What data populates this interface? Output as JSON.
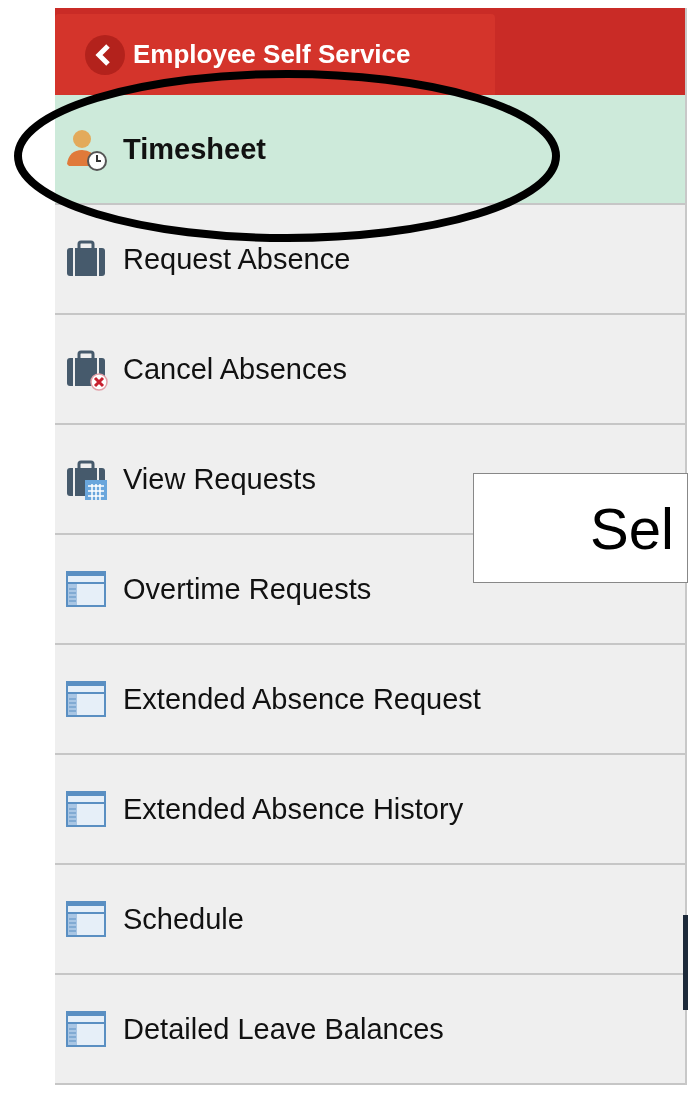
{
  "header": {
    "back_label": "Employee Self Service"
  },
  "menu": [
    {
      "label": "Timesheet",
      "kind": "person-clock",
      "selected": true
    },
    {
      "label": "Request Absence",
      "kind": "briefcase",
      "selected": false
    },
    {
      "label": "Cancel Absences",
      "kind": "briefcase-x",
      "selected": false
    },
    {
      "label": "View Requests",
      "kind": "briefcase-calendar",
      "selected": false
    },
    {
      "label": "Overtime Requests",
      "kind": "window",
      "selected": false
    },
    {
      "label": "Extended Absence Request",
      "kind": "window",
      "selected": false
    },
    {
      "label": "Extended Absence History",
      "kind": "window",
      "selected": false
    },
    {
      "label": "Schedule",
      "kind": "window",
      "selected": false
    },
    {
      "label": "Detailed Leave Balances",
      "kind": "window",
      "selected": false
    }
  ],
  "callout": {
    "text": "Sel"
  }
}
